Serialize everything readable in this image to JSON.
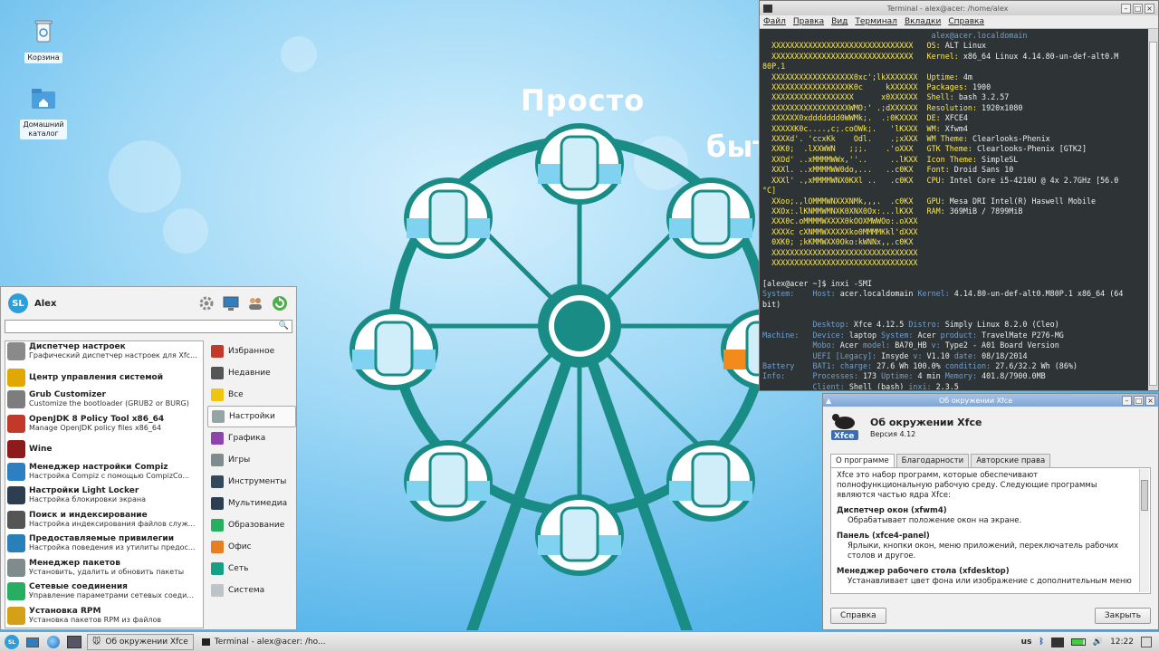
{
  "desktop": {
    "icons": [
      {
        "label": "Корзина"
      },
      {
        "label": "Домашний каталог"
      }
    ],
    "wallpaper_text": {
      "line1": "Просто",
      "line2": "быт"
    }
  },
  "terminal": {
    "title": "Terminal - alex@acer: /home/alex",
    "menu": [
      "Файл",
      "Правка",
      "Вид",
      "Терминал",
      "Вкладки",
      "Справка"
    ],
    "neofetch": {
      "userhost": "alex@acer.localdomain",
      "rows": [
        {
          "art": "XXXXXXXXXXXXXXXXXXXXXXXXXXXXXXX",
          "key": "OS:",
          "val": "ALT Linux"
        },
        {
          "art": "XXXXXXXXXXXXXXXXXXXXXXXXXXXXXXX",
          "key": "Kernel:",
          "val": "x86_64 Linux 4.14.80-un-def-alt0.M"
        },
        {
          "art": "80P.1",
          "key": "",
          "val": ""
        },
        {
          "art": "XXXXXXXXXXXXXXXXXX0xc';lkXXXXXXX",
          "key": "Uptime:",
          "val": "4m"
        },
        {
          "art": "XXXXXXXXXXXXXXXXXK0c     kXXXXXX",
          "key": "Packages:",
          "val": "1900"
        },
        {
          "art": "XXXXXXXXXXXXXXXXXX      x0XXXXXX",
          "key": "Shell:",
          "val": "bash 3.2.57"
        },
        {
          "art": "XXXXXXXXXXXXXXXXXWMO:' .;dXXXXXX",
          "key": "Resolution:",
          "val": "1920x1080"
        },
        {
          "art": "XXXXXX0xddddddd0WWMk;.  .:0KXXXX",
          "key": "DE:",
          "val": "XFCE4"
        },
        {
          "art": "XXXXXK0c....,c;.coOWk;.   'lKXXX",
          "key": "WM:",
          "val": "Xfwm4"
        },
        {
          "art": "XXXXd'. 'ccxKk    Odl.    .;xXXX",
          "key": "WM Theme:",
          "val": "Clearlooks-Phenix"
        },
        {
          "art": "XXK0;  .lXXWWN   ;;;.    .'oXXX",
          "key": "GTK Theme:",
          "val": "Clearlooks-Phenix [GTK2]"
        },
        {
          "art": "XXOd' ..xMMMMWWx,''..     ..lKXX",
          "key": "Icon Theme:",
          "val": "SimpleSL"
        },
        {
          "art": "XXXl. ..xMMMMWW0do,...   ..c0KX",
          "key": "Font:",
          "val": "Droid Sans 10"
        },
        {
          "art": "XXXl' .,xMMMMWNX0KXl ..   .c0KX",
          "key": "CPU:",
          "val": "Intel Core i5-4210U @ 4x 2.7GHz [56.0"
        },
        {
          "art": "°C]",
          "key": "",
          "val": ""
        },
        {
          "art": "XXoo;.,lOMMMWNXXXNMk,,,.  .c0KX",
          "key": "GPU:",
          "val": "Mesa DRI Intel(R) Haswell Mobile"
        },
        {
          "art": "XXOx:.lKNMMWMNXK0XNX0Ox:...lKXX",
          "key": "RAM:",
          "val": "369MiB / 7899MiB"
        },
        {
          "art": "XXX0c.oMMMMWXXXX0kOOXMWWOo:.oXXX",
          "key": "",
          "val": ""
        },
        {
          "art": "XXXXc cXNMMWXXXXXko0MMMMKkl'dXXX",
          "key": "",
          "val": ""
        },
        {
          "art": "0XK0; ;kKMMWXX0Oko:kWNNx,,.c0KX",
          "key": "",
          "val": ""
        },
        {
          "art": "XXXXXXXXXXXXXXXXXXXXXXXXXXXXXXXX",
          "key": "",
          "val": ""
        },
        {
          "art": "XXXXXXXXXXXXXXXXXXXXXXXXXXXXXXXX",
          "key": "",
          "val": ""
        }
      ]
    },
    "prompt1": "[alex@acer ~]$ inxi -SMI",
    "inxi": [
      {
        "parts": [
          [
            "b",
            "System:    "
          ],
          [
            "b",
            "Host: "
          ],
          [
            "w",
            "acer.localdomain "
          ],
          [
            "b",
            "Kernel: "
          ],
          [
            "w",
            "4.14.80-un-def-alt0.M80P.1 x86_64 (64"
          ]
        ]
      },
      {
        "parts": [
          [
            "w",
            "bit)"
          ]
        ]
      },
      {
        "parts": [
          [
            "w",
            ""
          ]
        ]
      },
      {
        "parts": [
          [
            "b",
            "           Desktop: "
          ],
          [
            "w",
            "Xfce 4.12.5 "
          ],
          [
            "b",
            "Distro: "
          ],
          [
            "w",
            "Simply Linux 8.2.0 (Cleo)"
          ]
        ]
      },
      {
        "parts": [
          [
            "b",
            "Machine:   "
          ],
          [
            "b",
            "Device: "
          ],
          [
            "w",
            "laptop "
          ],
          [
            "b",
            "System: "
          ],
          [
            "w",
            "Acer "
          ],
          [
            "b",
            "product: "
          ],
          [
            "w",
            "TravelMate P276-MG"
          ]
        ]
      },
      {
        "parts": [
          [
            "b",
            "           Mobo: "
          ],
          [
            "w",
            "Acer "
          ],
          [
            "b",
            "model: "
          ],
          [
            "w",
            "BA70_HB "
          ],
          [
            "b",
            "v: "
          ],
          [
            "w",
            "Type2 - A01 Board Version"
          ]
        ]
      },
      {
        "parts": [
          [
            "b",
            "           UEFI [Legacy]: "
          ],
          [
            "w",
            "Insyde "
          ],
          [
            "b",
            "v: "
          ],
          [
            "w",
            "V1.10 "
          ],
          [
            "b",
            "date: "
          ],
          [
            "w",
            "08/18/2014"
          ]
        ]
      },
      {
        "parts": [
          [
            "b",
            "Battery    "
          ],
          [
            "b",
            "BAT1: "
          ],
          [
            "b",
            "charge: "
          ],
          [
            "w",
            "27.6 Wh 100.0% "
          ],
          [
            "b",
            "condition: "
          ],
          [
            "w",
            "27.6/32.2 Wh (86%)"
          ]
        ]
      },
      {
        "parts": [
          [
            "b",
            "Info:      "
          ],
          [
            "b",
            "Processes: "
          ],
          [
            "w",
            "173 "
          ],
          [
            "b",
            "Uptime: "
          ],
          [
            "w",
            "4 min "
          ],
          [
            "b",
            "Memory: "
          ],
          [
            "w",
            "401.8/7900.0MB"
          ]
        ]
      },
      {
        "parts": [
          [
            "b",
            "           Client: "
          ],
          [
            "w",
            "Shell (bash) "
          ],
          [
            "b",
            "inxi: "
          ],
          [
            "w",
            "2.3.5"
          ]
        ]
      }
    ],
    "prompt2": "[alex@acer ~]$ "
  },
  "start_menu": {
    "user": "Alex",
    "search_placeholder": "",
    "apps": [
      {
        "title": "Диспетчер настроек",
        "desc": "Графический диспетчер настроек для Xfc...",
        "icon": "gear-icon",
        "color": "#8a8a8a"
      },
      {
        "title": "Центр управления системой",
        "desc": "",
        "icon": "alt-logo-icon",
        "color": "#e0a800"
      },
      {
        "title": "Grub Customizer",
        "desc": "Customize the bootloader (GRUB2 or BURG)",
        "icon": "gear-icon",
        "color": "#7d7d7d"
      },
      {
        "title": "OpenJDK 8 Policy Tool x86_64",
        "desc": "Manage OpenJDK policy files x86_64",
        "icon": "java-icon",
        "color": "#c0392b"
      },
      {
        "title": "Wine",
        "desc": "",
        "icon": "wine-icon",
        "color": "#8e1b1b"
      },
      {
        "title": "Менеджер настройки Compiz",
        "desc": "Настройка Compiz с помощью CompizCo...",
        "icon": "compiz-icon",
        "color": "#2c7fc0"
      },
      {
        "title": "Настройки Light Locker",
        "desc": "Настройка блокировки экрана",
        "icon": "monitor-icon",
        "color": "#2c3e50"
      },
      {
        "title": "Поиск и индексирование",
        "desc": "Настройка индексирования файлов служ...",
        "icon": "search-icon",
        "color": "#555555"
      },
      {
        "title": "Предоставляемые привилегии",
        "desc": "Настройка поведения из утилиты предос...",
        "icon": "privileges-icon",
        "color": "#2980b9"
      },
      {
        "title": "Менеджер пакетов",
        "desc": "Установить, удалить и обновить пакеты",
        "icon": "package-icon",
        "color": "#7f8c8d"
      },
      {
        "title": "Сетевые соединения",
        "desc": "Управление параметрами сетевых соеди...",
        "icon": "network-icon",
        "color": "#27ae60"
      },
      {
        "title": "Установка RPM",
        "desc": "Установка пакетов RPM из файлов",
        "icon": "rpm-icon",
        "color": "#d4a017"
      }
    ],
    "categories": [
      {
        "label": "Избранное",
        "color": "#c0392b"
      },
      {
        "label": "Недавние",
        "color": "#555555"
      },
      {
        "label": "Все",
        "color": "#f1c40f"
      },
      {
        "label": "Настройки",
        "color": "#95a5a6"
      },
      {
        "label": "Графика",
        "color": "#8e44ad"
      },
      {
        "label": "Игры",
        "color": "#7f8c8d"
      },
      {
        "label": "Инструменты",
        "color": "#34495e"
      },
      {
        "label": "Мультимедиа",
        "color": "#2c3e50"
      },
      {
        "label": "Образование",
        "color": "#27ae60"
      },
      {
        "label": "Офис",
        "color": "#e67e22"
      },
      {
        "label": "Сеть",
        "color": "#16a085"
      },
      {
        "label": "Система",
        "color": "#bdc3c7"
      }
    ],
    "selected_category": 3
  },
  "about": {
    "window_title": "Об окружении Xfce",
    "heading": "Об окружении Xfce",
    "version": "Версия 4.12",
    "tabs": [
      "О программе",
      "Благодарности",
      "Авторские права"
    ],
    "intro": "Xfce это набор программ, которые обеспечивают полнофункциональную рабочую среду. Следующие программы являются частью ядра Xfce:",
    "sections": [
      {
        "h": "Диспетчер окон (xfwm4)",
        "d": "Обрабатывает положение окон на экране."
      },
      {
        "h": "Панель (xfce4-panel)",
        "d": "Ярлыки, кнопки окон, меню приложений, переключатель рабочих столов и другое."
      },
      {
        "h": "Менеджер рабочего стола (xfdesktop)",
        "d": "Устанавливает цвет фона или изображение с дополнительным меню"
      }
    ],
    "help_button": "Справка",
    "close_button": "Закрыть"
  },
  "taskbar": {
    "tasks": [
      "Об окружении Xfce",
      "Terminal - alex@acer: /ho..."
    ],
    "layout": "us",
    "clock": "12:22"
  },
  "colors": {
    "teal": "#1a8c86",
    "accent": "#2f9ed8"
  }
}
